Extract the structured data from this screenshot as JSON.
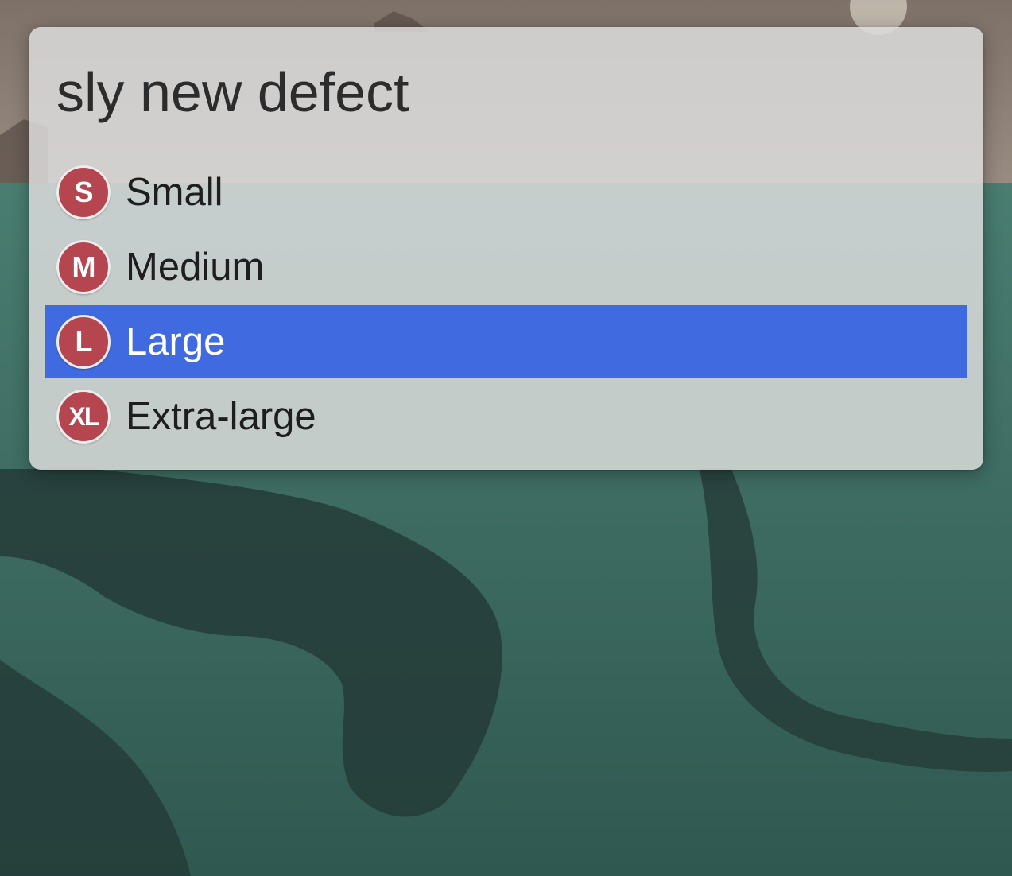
{
  "app": {
    "query_text": "sly new defect"
  },
  "results": [
    {
      "badge": "S",
      "label": "Small",
      "selected": false
    },
    {
      "badge": "M",
      "label": "Medium",
      "selected": false
    },
    {
      "badge": "L",
      "label": "Large",
      "selected": true
    },
    {
      "badge": "XL",
      "label": "Extra-large",
      "selected": false
    }
  ],
  "colors": {
    "selection": "#3f6ae0",
    "badge": "#b5454f",
    "panel": "#dedede",
    "wallpaper_sea": "#3f6b60",
    "wallpaper_sky": "#8a7d72"
  },
  "icons": {
    "badge": "size-badge-icon"
  }
}
